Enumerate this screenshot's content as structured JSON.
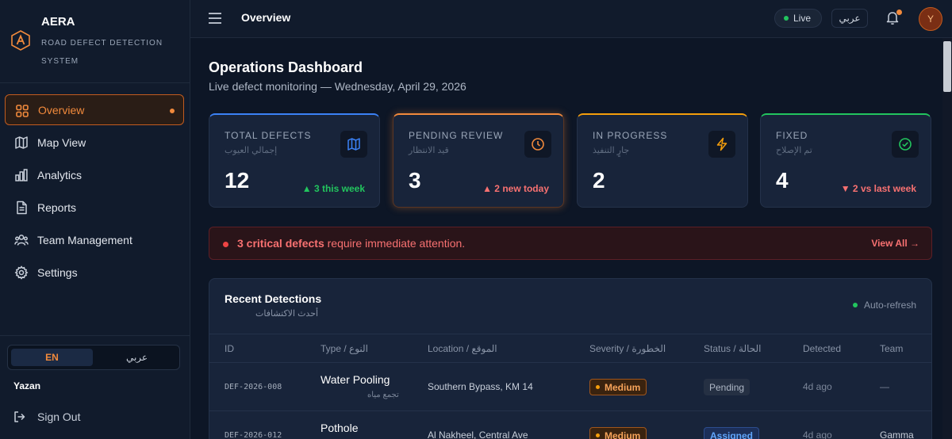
{
  "brand": {
    "name": "AERA",
    "tagline": "ROAD DEFECT DETECTION SYSTEM",
    "accent": "#f28a3c"
  },
  "sidebar": {
    "items": [
      {
        "label": "Overview",
        "icon": "grid-icon",
        "active": true
      },
      {
        "label": "Map View",
        "icon": "map-icon"
      },
      {
        "label": "Analytics",
        "icon": "bar-chart-icon"
      },
      {
        "label": "Reports",
        "icon": "document-icon"
      },
      {
        "label": "Team Management",
        "icon": "team-icon"
      },
      {
        "label": "Settings",
        "icon": "gear-icon"
      }
    ],
    "lang_en": "EN",
    "lang_ar": "عربي",
    "user_name": "Yazan",
    "sign_out": "Sign Out"
  },
  "topbar": {
    "title": "Overview",
    "live": "Live",
    "lang": "عربي",
    "avatar_initial": "Y"
  },
  "page": {
    "title": "Operations Dashboard",
    "subtitle": "Live defect monitoring — Wednesday, April 29, 2026"
  },
  "stats": [
    {
      "label": "TOTAL DEFECTS",
      "label_ar": "إجمالي العيوب",
      "value": "12",
      "delta": "▲ 3 this week",
      "icon": "map-icon",
      "color": "#3b82f6"
    },
    {
      "label": "PENDING REVIEW",
      "label_ar": "قيد الانتظار",
      "value": "3",
      "delta": "▲ 2 new today",
      "icon": "clock-icon",
      "color": "#f28a3c"
    },
    {
      "label": "IN PROGRESS",
      "label_ar": "جارٍ التنفيذ",
      "value": "2",
      "delta": "",
      "icon": "bolt-icon",
      "color": "#f59e0b"
    },
    {
      "label": "FIXED",
      "label_ar": "تم الإصلاح",
      "value": "4",
      "delta": "▼ 2 vs last week",
      "icon": "check-circle-icon",
      "color": "#22c55e"
    }
  ],
  "alert": {
    "strong": "3 critical defects",
    "rest": " require immediate attention.",
    "link": "View All →"
  },
  "table": {
    "title": "Recent Detections",
    "title_ar": "أحدث الاكتشافات",
    "auto_refresh": "Auto-refresh",
    "headers": [
      "ID",
      "Type / النوع",
      "Location / الموقع",
      "Severity / الخطورة",
      "Status / الحالة",
      "Detected",
      "Team"
    ],
    "rows": [
      {
        "id": "DEF-2026-008",
        "type": "Water Pooling",
        "type_ar": "تجمع مياه",
        "location": "Southern Bypass, KM 14",
        "severity": "Medium",
        "status": "Pending",
        "detected": "4d ago",
        "team": "—"
      },
      {
        "id": "DEF-2026-012",
        "type": "Pothole",
        "type_ar": "",
        "location": "Al Nakheel, Central Ave",
        "severity": "Medium",
        "status": "Assigned",
        "detected": "4d ago",
        "team": "Gamma"
      }
    ]
  }
}
